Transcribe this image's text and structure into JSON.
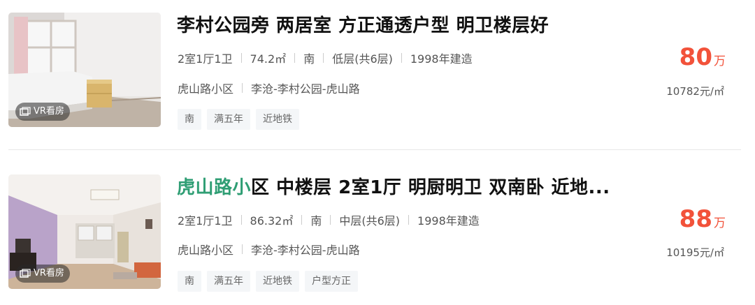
{
  "listings": [
    {
      "title": "李村公园旁 两居室 方正通透户型 明卫楼层好",
      "title_highlight": "",
      "title_rest": "李村公园旁 两居室 方正通透户型 明卫楼层好",
      "layout": "2室1厅1卫",
      "area": "74.2㎡",
      "orientation": "南",
      "floor": "低层(共6层)",
      "built": "1998年建造",
      "community": "虎山路小区",
      "district": "李沧-李村公园-虎山路",
      "tags": [
        "南",
        "满五年",
        "近地铁"
      ],
      "price": "80",
      "price_unit": "万",
      "unit_price": "10782元/㎡",
      "vr_label": "VR看房"
    },
    {
      "title": "虎山路小区 中楼层 2室1厅 明厨明卫 双南卧 近地...",
      "title_highlight": "虎山路小",
      "title_rest": "区 中楼层 2室1厅 明厨明卫 双南卧 近地...",
      "layout": "2室1厅1卫",
      "area": "86.32㎡",
      "orientation": "南",
      "floor": "中层(共6层)",
      "built": "1998年建造",
      "community": "虎山路小区",
      "district": "李沧-李村公园-虎山路",
      "tags": [
        "南",
        "满五年",
        "近地铁",
        "户型方正"
      ],
      "price": "88",
      "price_unit": "万",
      "unit_price": "10195元/㎡",
      "vr_label": "VR看房"
    }
  ],
  "colors": {
    "price": "#f2523a",
    "highlight": "#2f9e74",
    "tag_bg": "#f4f6f8"
  }
}
